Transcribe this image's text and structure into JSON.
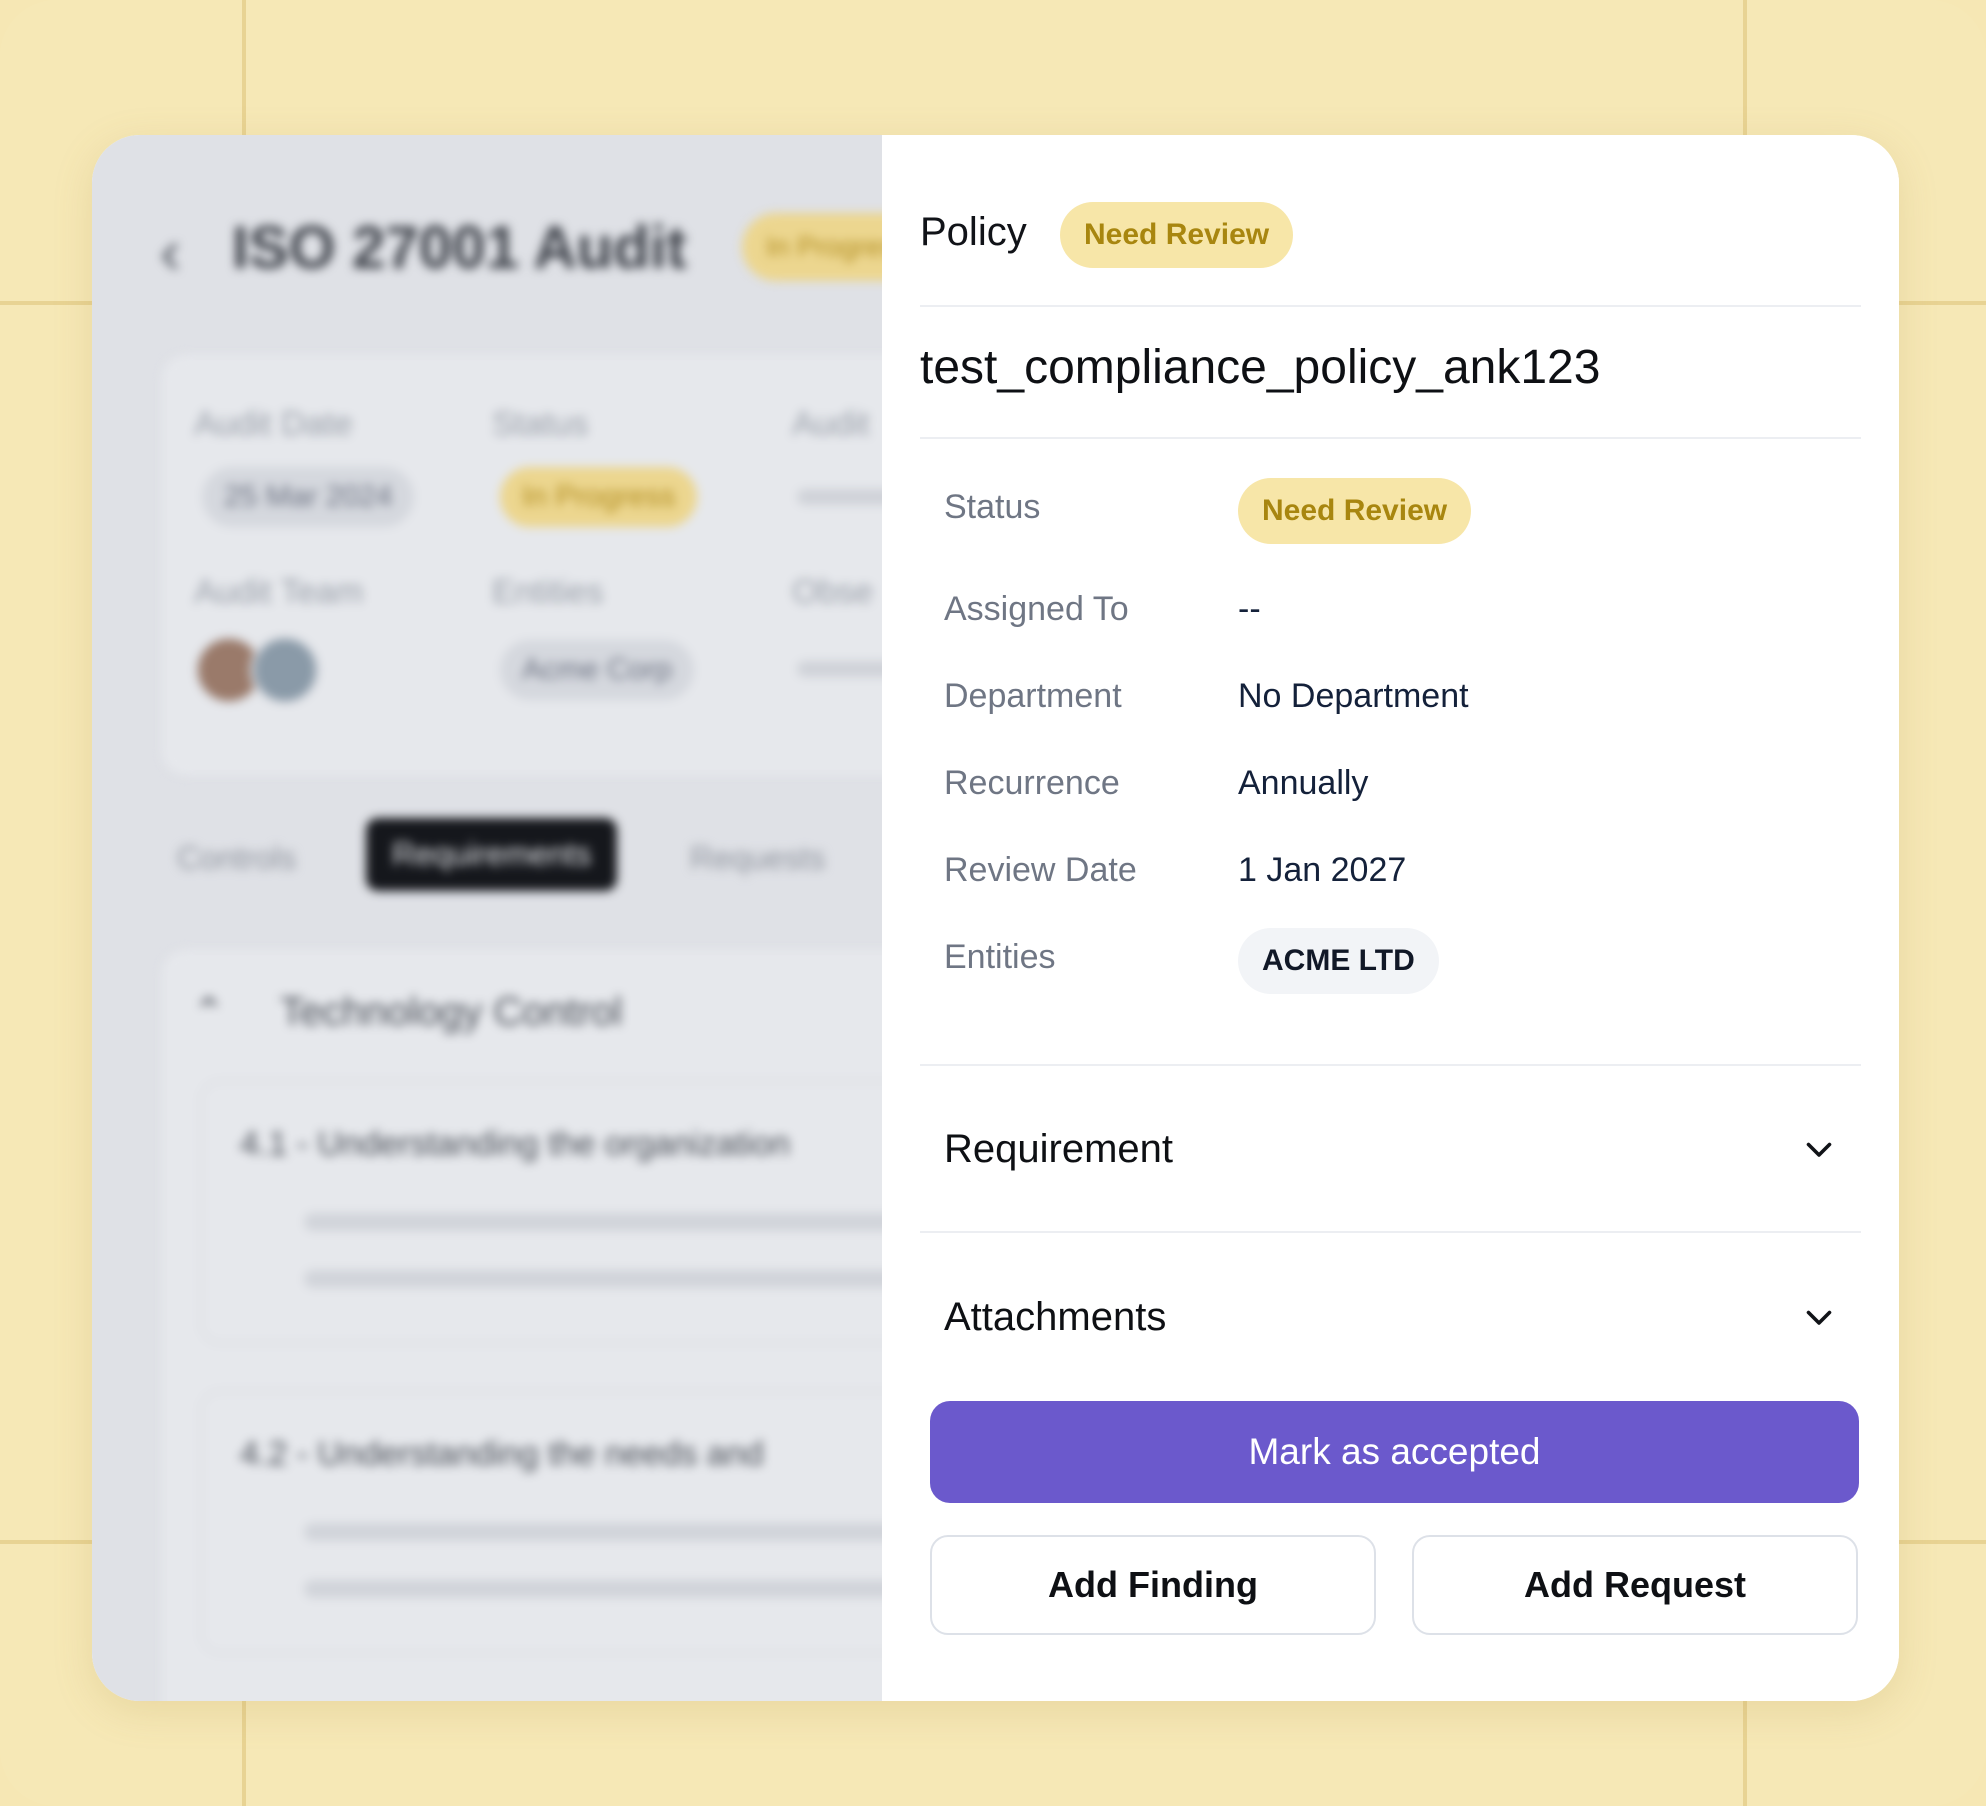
{
  "background": {
    "title": "ISO 27001 Audit",
    "title_badge": "In Progress",
    "info": {
      "audit_date_label": "Audit Date",
      "audit_date_value": "25 Mar 2024",
      "status_label": "Status",
      "status_value": "In Progress",
      "auditor_label": "Audit",
      "audit_team_label": "Audit Team",
      "entities_label": "Entities",
      "entities_value": "Acme Corp",
      "obs_label": "Obse"
    },
    "tabs": [
      "Controls",
      "Requirements",
      "Requests"
    ],
    "section_title": "Technology Control",
    "items": [
      "4.1 - Understanding the organization",
      "4.2 - Understanding the needs and"
    ]
  },
  "panel": {
    "type_label": "Policy",
    "header_badge": "Need Review",
    "doc_title": "test_compliance_policy_ank123",
    "fields": {
      "status_label": "Status",
      "status_value": "Need Review",
      "assigned_label": "Assigned To",
      "assigned_value": "--",
      "department_label": "Department",
      "department_value": "No Department",
      "recurrence_label": "Recurrence",
      "recurrence_value": "Annually",
      "review_date_label": "Review Date",
      "review_date_value": "1 Jan 2027",
      "entities_label": "Entities",
      "entities_value": "ACME LTD"
    },
    "sections": {
      "requirement": "Requirement",
      "attachments": "Attachments"
    },
    "actions": {
      "primary": "Mark as accepted",
      "add_finding": "Add Finding",
      "add_request": "Add Request"
    }
  },
  "colors": {
    "backdrop": "#f6e8b6",
    "badge_bg": "#f7e6a8",
    "badge_text": "#a8860f",
    "primary_button": "#6b59cc",
    "entity_chip": "#f2f4f7"
  },
  "icons": {
    "back": "chevron-left-icon",
    "expand": "chevron-down-icon",
    "collapse": "chevron-up-icon"
  }
}
